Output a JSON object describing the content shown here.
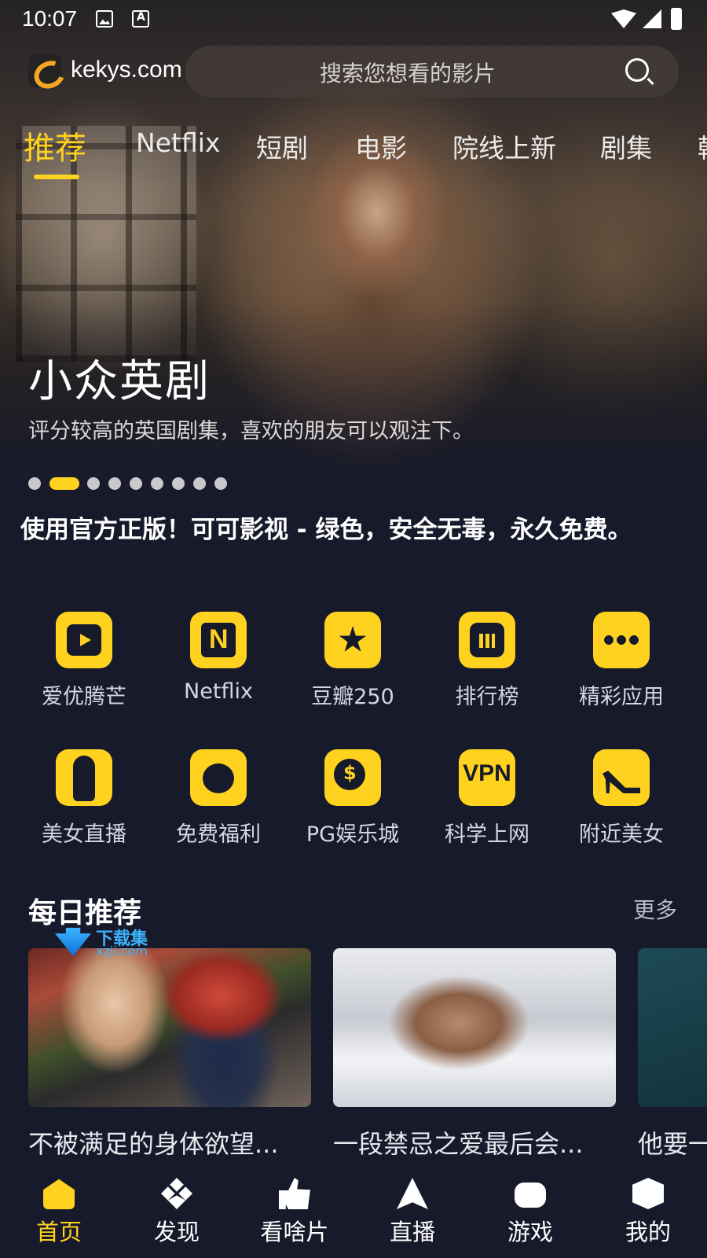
{
  "status_bar": {
    "time": "10:07"
  },
  "header": {
    "site": "kekys.com",
    "search_placeholder": "搜索您想看的影片"
  },
  "tabs": [
    {
      "label": "推荐",
      "active": true
    },
    {
      "label": "Netflix"
    },
    {
      "label": "短剧"
    },
    {
      "label": "电影"
    },
    {
      "label": "院线上新"
    },
    {
      "label": "剧集"
    },
    {
      "label": "韩"
    }
  ],
  "banner": {
    "title": "小众英剧",
    "subtitle": "评分较高的英国剧集，喜欢的朋友可以观注下。",
    "dot_count": 9,
    "active_dot": 2
  },
  "notice": "使用官方正版！可可影视 - 绿色，安全无毒，永久免费。",
  "shortcuts": [
    {
      "label": "爱优腾芒",
      "icon": "play-icon"
    },
    {
      "label": "Netflix",
      "icon": "netflix-n-icon"
    },
    {
      "label": "豆瓣250",
      "icon": "star-icon"
    },
    {
      "label": "排行榜",
      "icon": "ranking-chart-icon"
    },
    {
      "label": "精彩应用",
      "icon": "more-dots-icon"
    },
    {
      "label": "美女直播",
      "icon": "woman-silhouette-icon"
    },
    {
      "label": "免费福利",
      "icon": "fruit-icon"
    },
    {
      "label": "PG娱乐城",
      "icon": "coin-icon"
    },
    {
      "label": "科学上网",
      "icon": "vpn-icon"
    },
    {
      "label": "附近美女",
      "icon": "high-heel-icon"
    }
  ],
  "vpn_icon_text": "VPN",
  "daily": {
    "title": "每日推荐",
    "more": "更多",
    "items": [
      {
        "title": "不被满足的身体欲望..."
      },
      {
        "title": "一段禁忌之爱最后会..."
      },
      {
        "title": "他要一"
      }
    ]
  },
  "watermark": {
    "text": "下载集",
    "sub": "xzji.com"
  },
  "bottom_nav": [
    {
      "label": "首页",
      "icon": "home-icon",
      "active": true
    },
    {
      "label": "发现",
      "icon": "discover-icon"
    },
    {
      "label": "看啥片",
      "icon": "thumbs-up-icon"
    },
    {
      "label": "直播",
      "icon": "live-icon"
    },
    {
      "label": "游戏",
      "icon": "gamepad-icon"
    },
    {
      "label": "我的",
      "icon": "profile-icon"
    }
  ],
  "colors": {
    "accent": "#ffd21f",
    "background": "#171a2b"
  }
}
